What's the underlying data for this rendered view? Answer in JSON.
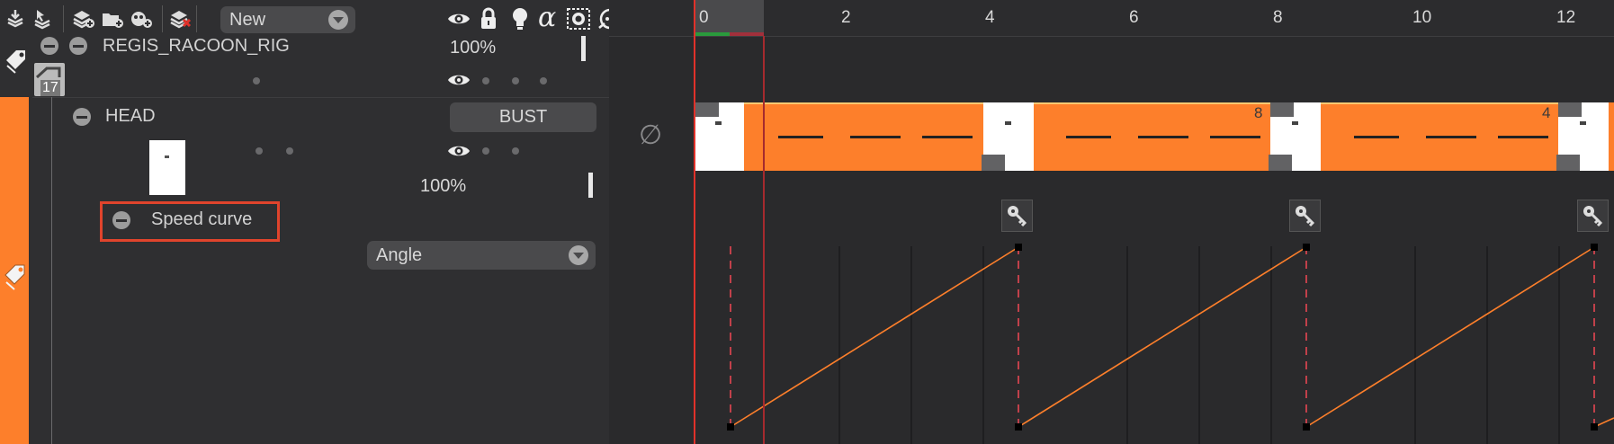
{
  "toolbar": {
    "icons": [
      "import-layer-icon",
      "select-layer-icon",
      "add-layer-icon",
      "add-folder-icon",
      "add-group-icon",
      "delete-layer-icon"
    ],
    "composition_select": "New",
    "column_icons": [
      "eye-icon",
      "lock-icon",
      "bulb-icon",
      "alpha-icon",
      "mask-icon",
      "onion-icon"
    ]
  },
  "layers": {
    "rig": {
      "name": "REGIS_RACOON_RIG",
      "opacity": "100%",
      "badge": "17"
    },
    "head": {
      "name": "HEAD",
      "switch_value": "BUST",
      "opacity": "100%"
    },
    "speed_curve": {
      "name": "Speed curve",
      "param_select": "Angle"
    }
  },
  "timeline": {
    "ruler_labels": [
      "0",
      "2",
      "4",
      "6",
      "8",
      "10",
      "12"
    ],
    "current_frame": 0,
    "empty_symbol": "∅",
    "block_counts": [
      "8",
      "4"
    ],
    "accent_color": "#fd7f2b",
    "playhead_color": "#e0312a"
  }
}
